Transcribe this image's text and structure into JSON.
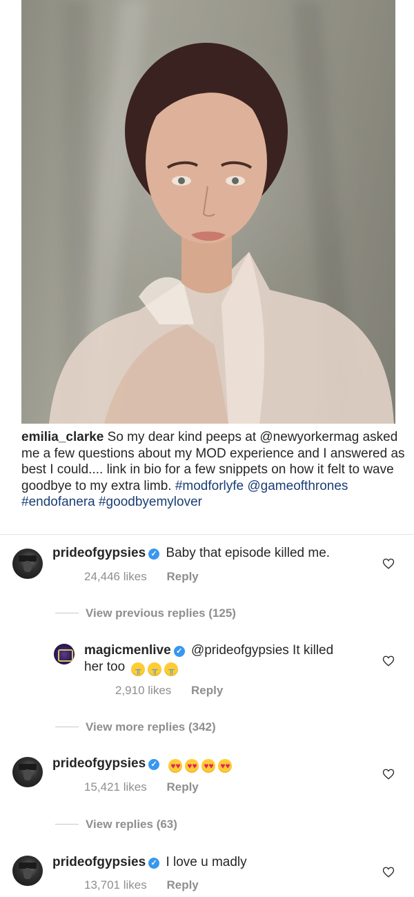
{
  "post": {
    "username": "emilia_clarke",
    "caption": "So my dear kind peeps at @newyorkermag asked me a few questions about my MOD experience and I answered as best I could.... link in bio for a few snippets on how it felt to wave goodbye to my extra limb.",
    "tags": "#modforlyfe @gameofthrones #endofanera #goodbyemylover"
  },
  "comments": [
    {
      "username": "prideofgypsies",
      "text": "Baby that episode killed me.",
      "likes": "24,446 likes",
      "reply_label": "Reply",
      "view_replies": "View previous replies (125)"
    },
    {
      "username": "magicmenlive",
      "text_line1": "@prideofgypsies It killed",
      "text_line2": "her too",
      "likes": "2,910 likes",
      "reply_label": "Reply",
      "view_replies": "View more replies (342)"
    },
    {
      "username": "prideofgypsies",
      "text": "",
      "likes": "15,421 likes",
      "reply_label": "Reply",
      "view_replies": "View replies (63)"
    },
    {
      "username": "prideofgypsies",
      "text": "I love u madly",
      "likes": "13,701 likes",
      "reply_label": "Reply"
    }
  ],
  "icons": {
    "verified": "verified-badge-icon",
    "heart": "heart-outline-icon",
    "emoji_cry": "loudly-crying-face-emoji",
    "emoji_love": "heart-eyes-emoji"
  },
  "colors": {
    "verified": "#3897f0",
    "muted": "#8e8e8e",
    "text": "#262626",
    "hashtag": "#1a3d74"
  }
}
